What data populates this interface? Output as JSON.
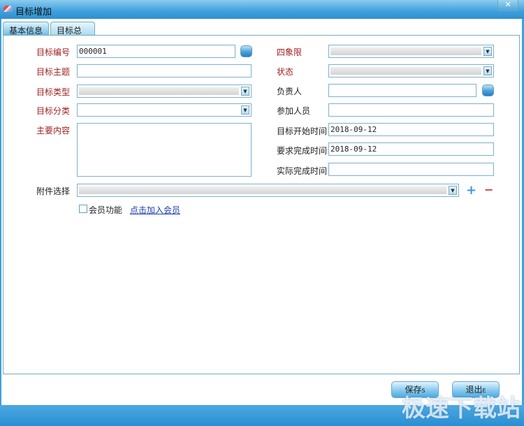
{
  "window": {
    "title": "目标增加",
    "close": "✕",
    "icon": "app-icon"
  },
  "tabs": [
    {
      "label": "基本信息",
      "active": true
    },
    {
      "label": "目标总结",
      "active": false
    }
  ],
  "left": {
    "goal_no": {
      "label": "目标编号",
      "value": "000001"
    },
    "subject": {
      "label": "目标主题",
      "value": ""
    },
    "type": {
      "label": "目标类型",
      "value": ""
    },
    "category": {
      "label": "目标分类",
      "value": ""
    },
    "content": {
      "label": "主要内容",
      "value": ""
    }
  },
  "right": {
    "quadrant": {
      "label": "四象限",
      "value": ""
    },
    "status": {
      "label": "状态",
      "value": ""
    },
    "owner": {
      "label": "负责人",
      "value": ""
    },
    "participants": {
      "label": "参加人员",
      "value": ""
    },
    "start": {
      "label": "目标开始时间",
      "value": "2018-09-12"
    },
    "required": {
      "label": "要求完成时间",
      "value": "2018-09-12"
    },
    "actual": {
      "label": "实际完成时间",
      "value": ""
    }
  },
  "attachment": {
    "label": "附件选择",
    "value": "",
    "add": "+",
    "remove": "−"
  },
  "member": {
    "checkbox_label": "会员功能",
    "checked": false,
    "link": "点击加入会员"
  },
  "buttons": {
    "save": "保存",
    "save_key": "S",
    "exit": "退出",
    "exit_key": "E"
  },
  "watermark": "极速下载站",
  "colors": {
    "accent": "#3ea0dc",
    "required_label": "#a02020",
    "link": "#1a3fb0"
  }
}
